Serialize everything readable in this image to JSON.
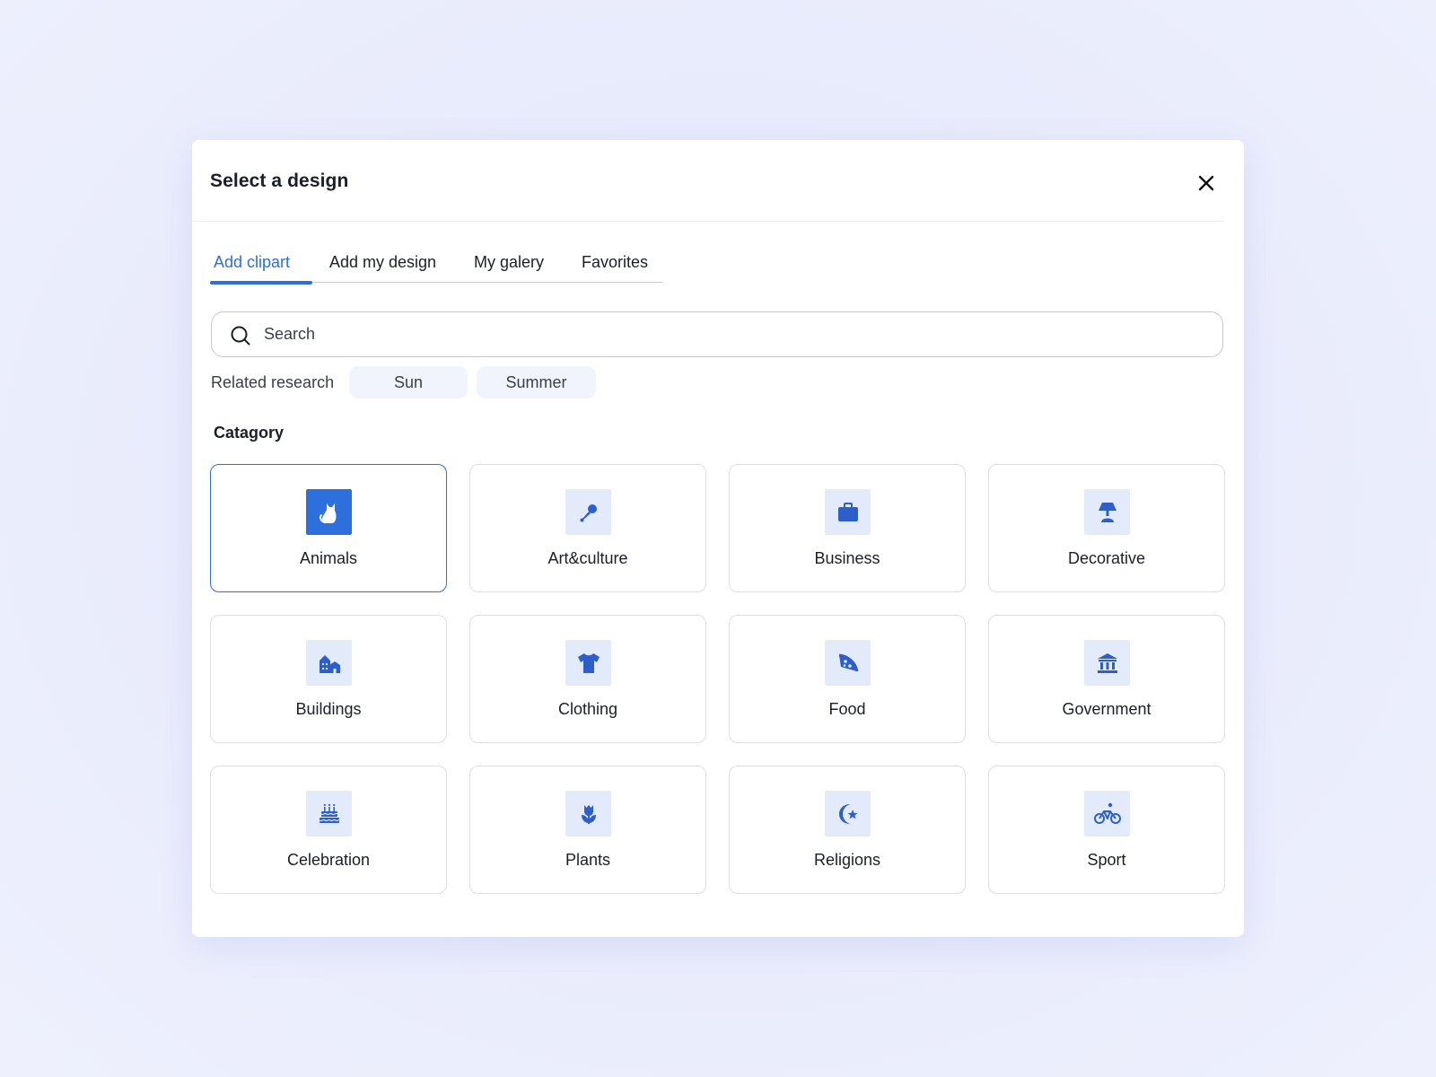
{
  "dialog": {
    "title": "Select a design",
    "close_icon": "close-icon"
  },
  "tabs": [
    {
      "label": "Add clipart",
      "active": true
    },
    {
      "label": "Add my design",
      "active": false
    },
    {
      "label": "My galery",
      "active": false
    },
    {
      "label": "Favorites",
      "active": false
    }
  ],
  "search": {
    "placeholder": "Search",
    "value": "",
    "icon": "search-icon"
  },
  "related": {
    "label": "Related research",
    "chips": [
      "Sun",
      "Summer"
    ]
  },
  "category": {
    "title": "Catagory",
    "items": [
      {
        "label": "Animals",
        "icon": "cat-icon",
        "selected": true
      },
      {
        "label": "Art&culture",
        "icon": "microphone-icon",
        "selected": false
      },
      {
        "label": "Business",
        "icon": "briefcase-icon",
        "selected": false
      },
      {
        "label": "Decorative",
        "icon": "lamp-icon",
        "selected": false
      },
      {
        "label": "Buildings",
        "icon": "buildings-icon",
        "selected": false
      },
      {
        "label": "Clothing",
        "icon": "tshirt-icon",
        "selected": false
      },
      {
        "label": "Food",
        "icon": "pizza-icon",
        "selected": false
      },
      {
        "label": "Government",
        "icon": "government-building-icon",
        "selected": false
      },
      {
        "label": "Celebration",
        "icon": "cake-icon",
        "selected": false
      },
      {
        "label": "Plants",
        "icon": "tulip-icon",
        "selected": false
      },
      {
        "label": "Religions",
        "icon": "crescent-star-icon",
        "selected": false
      },
      {
        "label": "Sport",
        "icon": "bicycle-icon",
        "selected": false
      }
    ]
  },
  "colors": {
    "accent": "#2e6fde",
    "icon_tile_bg": "#e3ebfb",
    "chip_bg": "#f1f4fc",
    "card_border": "#dcdfe6"
  }
}
